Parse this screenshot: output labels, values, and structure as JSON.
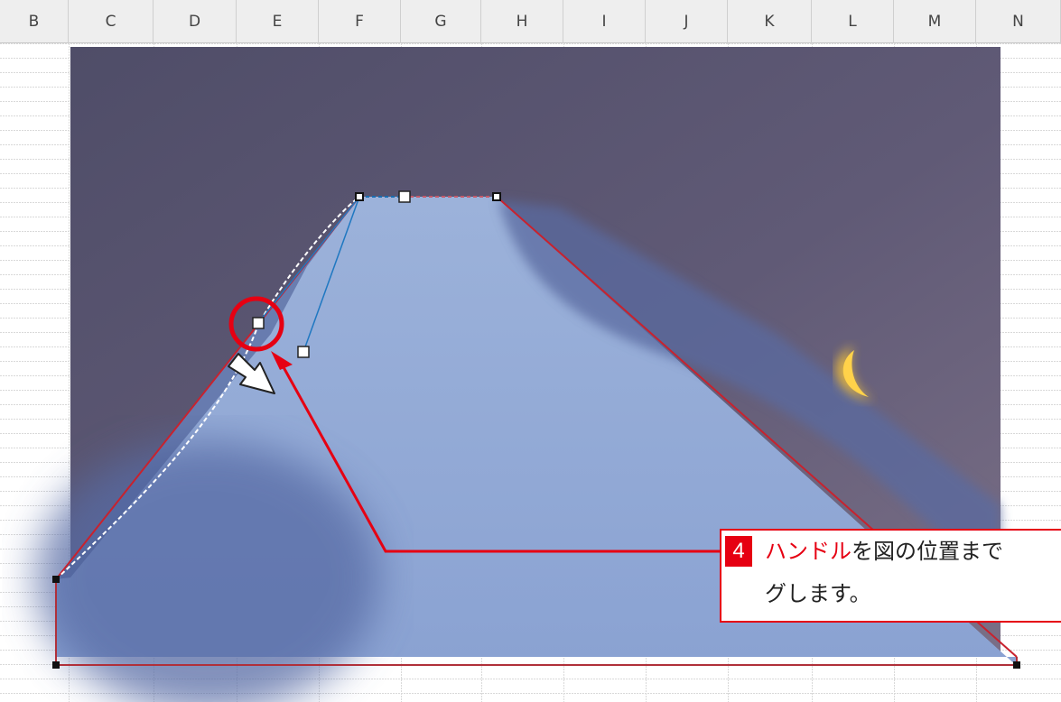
{
  "spreadsheet": {
    "columns": [
      "B",
      "C",
      "D",
      "E",
      "F",
      "G",
      "H",
      "I",
      "J",
      "K",
      "L",
      "M",
      "N"
    ]
  },
  "callout": {
    "step_number": "4",
    "text_highlight": "ハンドル",
    "text_line1_rest": "を図の位置まで",
    "text_line2": "グします。"
  },
  "colors": {
    "accent": "#e60012",
    "sky": "#5f5a75",
    "mountain": "#98aed8",
    "moon": "#f2c13a"
  },
  "icons": {
    "selection_handle": "square-handle",
    "drag_arrow": "white-arrow-icon"
  }
}
